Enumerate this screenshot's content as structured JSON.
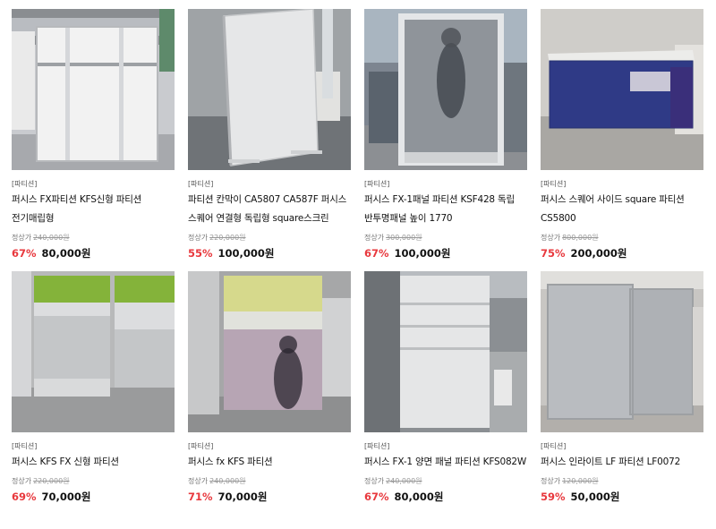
{
  "products": [
    {
      "category": "[파티션]",
      "name": "퍼시스 FX파티션 KFS신형 파티션 전기매립형",
      "regular_label": "정상가",
      "regular_price": "240,000원",
      "discount": "67%",
      "price": "80,000원"
    },
    {
      "category": "[파티션]",
      "name": "파티션 칸막이 CA5807 CA587F 퍼시스 스퀘어 연결형 독립형 square스크린",
      "regular_label": "정상가",
      "regular_price": "220,000원",
      "discount": "55%",
      "price": "100,000원"
    },
    {
      "category": "[파티션]",
      "name": "퍼시스 FX-1패널 파티션 KSF428 독립 반투명패널 높이 1770",
      "regular_label": "정상가",
      "regular_price": "300,000원",
      "discount": "67%",
      "price": "100,000원"
    },
    {
      "category": "[파티션]",
      "name": "퍼시스 스퀘어 사이드 square 파티션 CS5800",
      "regular_label": "정상가",
      "regular_price": "800,000원",
      "discount": "75%",
      "price": "200,000원"
    },
    {
      "category": "[파티션]",
      "name": "퍼시스 KFS FX 신형 파티션",
      "regular_label": "정상가",
      "regular_price": "220,000원",
      "discount": "69%",
      "price": "70,000원"
    },
    {
      "category": "[파티션]",
      "name": "퍼시스 fx KFS 파티션",
      "regular_label": "정상가",
      "regular_price": "240,000원",
      "discount": "71%",
      "price": "70,000원"
    },
    {
      "category": "[파티션]",
      "name": "퍼시스 FX-1 양면 패널 파티션 KFS082W",
      "regular_label": "정상가",
      "regular_price": "240,000원",
      "discount": "67%",
      "price": "80,000원"
    },
    {
      "category": "[파티션]",
      "name": "퍼시스 인라이트 LF 파티션 LF0072",
      "regular_label": "정상가",
      "regular_price": "120,000원",
      "discount": "59%",
      "price": "50,000원"
    }
  ],
  "colors": {
    "discount": "#e8383d",
    "text": "#111111",
    "muted": "#777777"
  }
}
